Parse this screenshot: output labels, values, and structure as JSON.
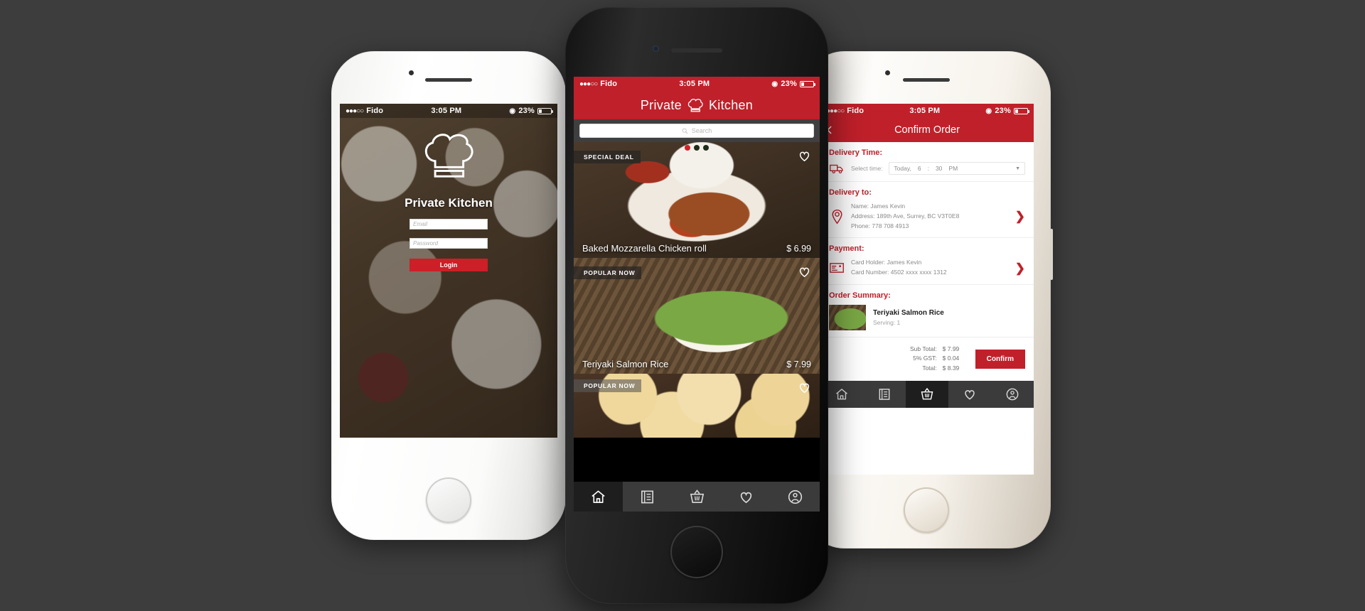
{
  "theme": {
    "brand_red": "#c0202a",
    "button_red": "#cc1f27",
    "background": "#3d3d3d"
  },
  "status_bar": {
    "carrier": "Fido",
    "signal_dots": "●●●○○",
    "time": "3:05 PM",
    "battery_percent": "23%"
  },
  "login_screen": {
    "logo_icon": "chef-hat-icon",
    "brand": "Private Kitchen",
    "email_placeholder": "Email",
    "password_placeholder": "Password",
    "login_label": "Login"
  },
  "home_screen": {
    "header": {
      "title_left": "Private",
      "title_right": "Kitchen",
      "logo_icon": "chef-hat-icon"
    },
    "search": {
      "placeholder": "Search",
      "icon": "search-icon"
    },
    "pager": {
      "dots": [
        "#d0212a",
        "#1d2b18",
        "#1d2b18"
      ],
      "active_index": 0
    },
    "cards": [
      {
        "badge": "SPECIAL DEAL",
        "name": "Baked Mozzarella Chicken roll",
        "price": "$ 6.99",
        "photo": "ph-chicken",
        "favorite_icon": "heart-icon"
      },
      {
        "badge": "POPULAR NOW",
        "name": "Teriyaki Salmon Rice",
        "price": "$ 7.99",
        "photo": "ph-salmon",
        "favorite_icon": "heart-icon"
      },
      {
        "badge": "POPULAR NOW",
        "name": "",
        "price": "",
        "photo": "ph-bread",
        "favorite_icon": "heart-icon"
      }
    ],
    "tabbar": {
      "active_index": 0,
      "items": [
        {
          "icon": "home-icon",
          "name": "tab-home"
        },
        {
          "icon": "menu-book-icon",
          "name": "tab-menu"
        },
        {
          "icon": "basket-icon",
          "name": "tab-basket"
        },
        {
          "icon": "heart-icon",
          "name": "tab-favorites"
        },
        {
          "icon": "profile-icon",
          "name": "tab-profile"
        }
      ]
    }
  },
  "confirm_order_screen": {
    "header": {
      "title": "Confirm Order",
      "back_icon": "back-arrow-icon"
    },
    "delivery_time": {
      "heading": "Delivery Time:",
      "icon": "delivery-truck-icon",
      "label": "Select time:",
      "day": "Today,",
      "hour": "6",
      "separator": ":",
      "minute": "30",
      "meridiem": "PM",
      "caret": "▼"
    },
    "delivery_to": {
      "heading": "Delivery to:",
      "icon": "location-pin-icon",
      "name": "Name: James Kevin",
      "address": "Address: 189th Ave, Surrey, BC  V3T0E8",
      "phone": "Phone: 778 708 4913",
      "chevron": "❯"
    },
    "payment": {
      "heading": "Payment:",
      "icon": "credit-card-icon",
      "card_holder": "Card Holder: James Kevin",
      "card_number": "Card Number: 4502 xxxx xxxx 1312",
      "chevron": "❯"
    },
    "order_summary": {
      "heading": "Order Summary:",
      "item_name": "Teriyaki Salmon Rice",
      "serving": "Serving: 1",
      "thumbnail": "teriyaki-salmon-rice-thumbnail"
    },
    "totals": {
      "sub_total_label": "Sub Total:",
      "sub_total_value": "$ 7.99",
      "gst_label": "5% GST:",
      "gst_value": "$ 0.04",
      "total_label": "Total:",
      "total_value": "$ 8.39",
      "confirm_label": "Confirm"
    },
    "tabbar": {
      "active_index": 2,
      "items": [
        {
          "icon": "home-icon",
          "name": "tab-home"
        },
        {
          "icon": "menu-book-icon",
          "name": "tab-menu"
        },
        {
          "icon": "basket-icon",
          "name": "tab-basket"
        },
        {
          "icon": "heart-icon",
          "name": "tab-favorites"
        },
        {
          "icon": "profile-icon",
          "name": "tab-profile"
        }
      ]
    }
  }
}
